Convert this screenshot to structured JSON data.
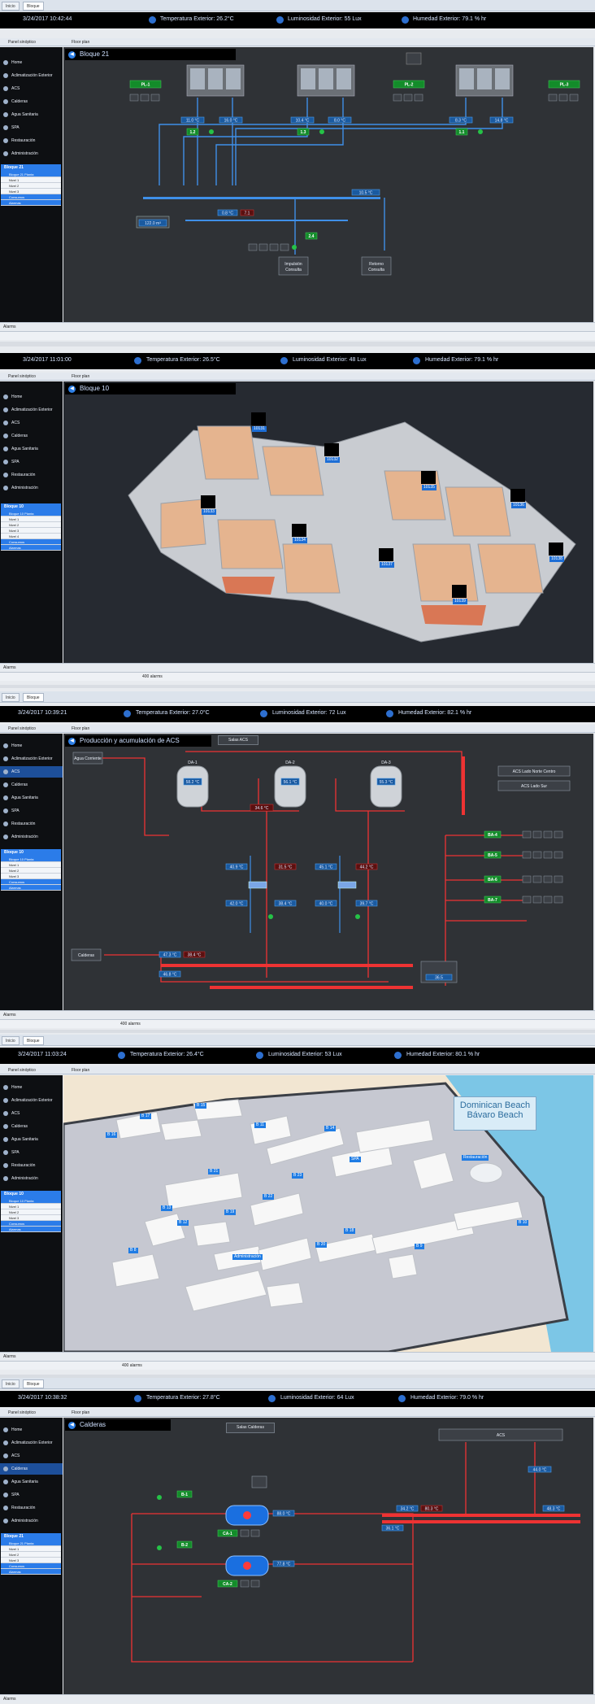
{
  "tabs": {
    "t1": "Inicio",
    "t2": "Bloque"
  },
  "floor_panel_label": "Floor plan",
  "sidebar_header_label": "Panel sinóptico",
  "nav": [
    "Home",
    "Aclimatización Exterior",
    "ACS",
    "Calderas",
    "Agua Sanitaria",
    "SPA",
    "Restauración",
    "Administración"
  ],
  "panels": [
    {
      "datetime": "3/24/2017 10:42:44",
      "temp": "Temperatura Exterior: 26.2°C",
      "lum": "Luminosidad Exterior: 55 Lux",
      "hum": "Humedad Exterior: 79.1 % hr",
      "title": "Bloque 21",
      "bloque": "Bloque 21",
      "subitems": [
        "Bloque 21 Planta",
        "Nivel 1",
        "Nivel 2",
        "Nivel 3",
        "Consumos",
        "Alarmas"
      ],
      "status_left": "Alarms"
    },
    {
      "datetime": "3/24/2017 11:01:00",
      "temp": "Temperatura Exterior: 26.5°C",
      "lum": "Luminosidad Exterior: 48 Lux",
      "hum": "Humedad Exterior: 79.1 % hr",
      "title": "Bloque 10",
      "bloque": "Bloque 10",
      "subitems": [
        "Bloque 10 Planta",
        "Nivel 1",
        "Nivel 2",
        "Nivel 3",
        "Nivel 4",
        "Consumos",
        "Alarmas"
      ],
      "status_left": "Alarms",
      "status_count": "400 alarms"
    },
    {
      "datetime": "3/24/2017 10:39:21",
      "temp": "Temperatura Exterior: 27.0°C",
      "lum": "Luminosidad Exterior: 72 Lux",
      "hum": "Humedad Exterior: 82.1 % hr",
      "title": "Producción y acumulación de ACS",
      "extra_btn": "Salas ACS",
      "bloque": "Bloque 10",
      "subitems": [
        "Bloque 10 Planta",
        "Nivel 1",
        "Nivel 2",
        "Nivel 3",
        "Consumos",
        "Alarmas"
      ],
      "status_left": "Alarms",
      "status_count": "400 alarms"
    },
    {
      "datetime": "3/24/2017 11:03:24",
      "temp": "Temperatura Exterior: 26.4°C",
      "lum": "Luminosidad Exterior: 53 Lux",
      "hum": "Humedad Exterior: 80.1 % hr",
      "resort_name": "Dominican Beach",
      "resort_sub": "Bávaro Beach",
      "bloque": "Bloque 10",
      "subitems": [
        "Bloque 10 Planta",
        "Nivel 1",
        "Nivel 2",
        "Nivel 3",
        "Consumos",
        "Alarmas"
      ],
      "status_left": "Alarms",
      "status_count": "400 alarms"
    },
    {
      "datetime": "3/24/2017 10:38:32",
      "temp": "Temperatura Exterior: 27.8°C",
      "lum": "Luminosidad Exterior: 64 Lux",
      "hum": "Humedad Exterior: 79.0 % hr",
      "title": "Calderas",
      "extra_btn": "Salas Calderas",
      "bloque": "Bloque 21",
      "subitems": [
        "Bloque 21 Planta",
        "Nivel 1",
        "Nivel 2",
        "Nivel 3",
        "Consumos",
        "Alarmas"
      ],
      "status_left": "Alarms"
    }
  ],
  "bloque21": {
    "ph": [
      "PL-1",
      "PL-2",
      "PL-3"
    ],
    "temps": [
      "11.0 °C",
      "16.0 °C",
      "10.4 °C",
      "8.0 °C",
      "8.3 °C",
      "14.8 °C"
    ],
    "valves": [
      "1.2",
      "1.3",
      "1.1"
    ],
    "collector": "10.5 °C",
    "return": "0.8 °C",
    "ret2": "7.1",
    "tank": "122.0 m³",
    "pump": "2.4",
    "dest1a": "Impulsión",
    "dest1b": "Consulta",
    "dest2a": "Retorno",
    "dest2b": "Consulta",
    "pump_ctrls": [
      "M",
      "A"
    ]
  },
  "bloque10": {
    "rooms": [
      "10131",
      "10132",
      "10133",
      "10134",
      "10135",
      "10136",
      "10137",
      "10138",
      "10139"
    ]
  },
  "acs": {
    "water_in": "Agua Corriente",
    "tanks": [
      "DA-1",
      "DA-2",
      "DA-3"
    ],
    "tank_temps": [
      "58.2 °C",
      "56.1 °C",
      "55.3 °C"
    ],
    "red_temp": "34.6 °C",
    "outlets": [
      "ACS Lado Norte Centro",
      "ACS Lado Sur"
    ],
    "pumps": [
      "BA-4",
      "BA-5",
      "BA-6",
      "BA-7"
    ],
    "readings": [
      "40.9 °C",
      "31.5 °C",
      "42.0 °C",
      "38.4 °C",
      "45.1 °C",
      "44.2 °C",
      "40.0 °C",
      "39.7 °C"
    ],
    "calderas": "Calderas",
    "bottom": [
      "47.3 °C",
      "38.4 °C",
      "46.8 °C"
    ],
    "box_val": "36.5"
  },
  "resort": {
    "labels": [
      "B 17",
      "B 16",
      "B 15",
      "B 11",
      "B 14",
      "B 21",
      "B 23",
      "B 22",
      "B 13",
      "B 12",
      "B 19",
      "B 18",
      "SPA",
      "Restauración",
      "B 10",
      "B 9",
      "B 20",
      "B 8",
      "Administración"
    ]
  },
  "calderas": {
    "acs_label": "ACS",
    "units": [
      "CA-1",
      "CA-2"
    ],
    "temps": [
      "88.0 °C",
      "77.8 °C"
    ],
    "pumps": [
      "B-1",
      "B-2"
    ],
    "right": [
      "44.0 °C",
      "34.2 °C",
      "80.3 °C",
      "36.1 °C",
      "48.3 °C"
    ]
  }
}
